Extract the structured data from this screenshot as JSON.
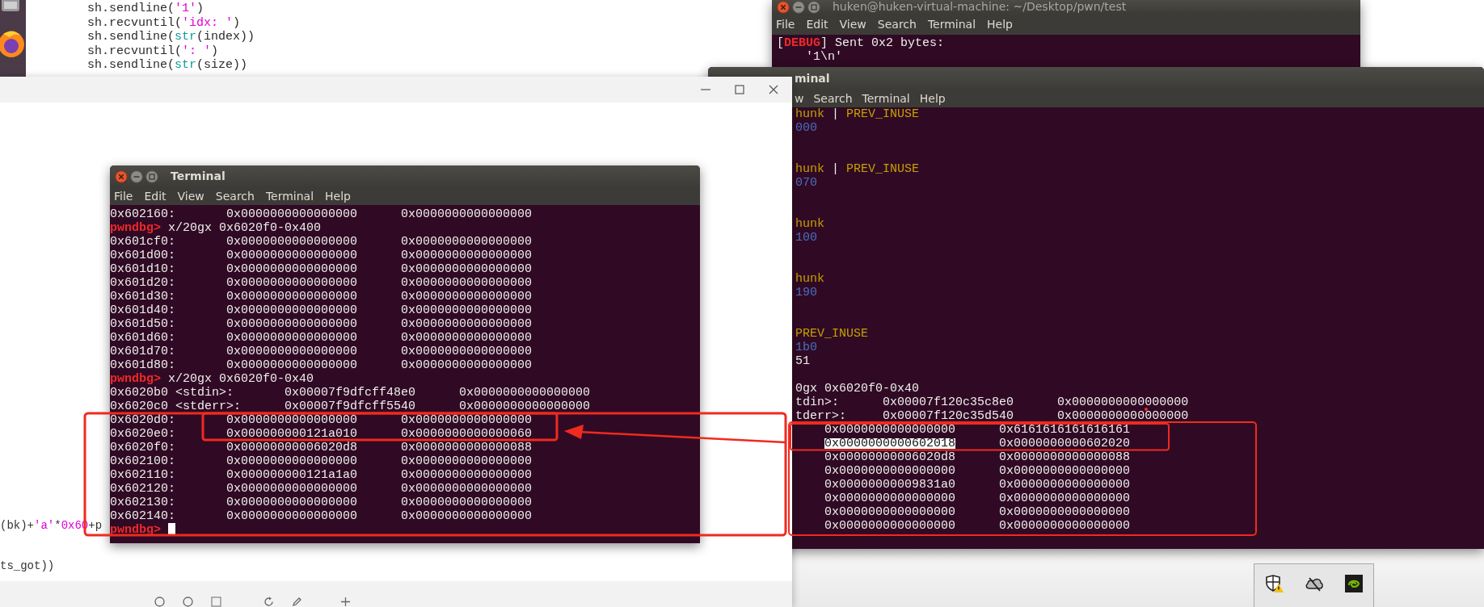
{
  "editor": {
    "code_lines": [
      [
        {
          "text": "sh.sendline(",
          "kind": "plain"
        },
        {
          "text": "'1'",
          "kind": "string"
        },
        {
          "text": ")",
          "kind": "plain"
        }
      ],
      [
        {
          "text": "sh.recvuntil(",
          "kind": "plain"
        },
        {
          "text": "'idx: '",
          "kind": "string"
        },
        {
          "text": ")",
          "kind": "plain"
        }
      ],
      [
        {
          "text": "sh.sendline(",
          "kind": "plain"
        },
        {
          "text": "str",
          "kind": "builtin"
        },
        {
          "text": "(index))",
          "kind": "plain"
        }
      ],
      [
        {
          "text": "sh.recvuntil(",
          "kind": "plain"
        },
        {
          "text": "': '",
          "kind": "string"
        },
        {
          "text": ")",
          "kind": "plain"
        }
      ],
      [
        {
          "text": "sh.sendline(",
          "kind": "plain"
        },
        {
          "text": "str",
          "kind": "builtin"
        },
        {
          "text": "(size))",
          "kind": "plain"
        }
      ]
    ]
  },
  "top_terminal": {
    "title": "huken@huken-virtual-machine: ~/Desktop/pwn/test",
    "menu": [
      "File",
      "Edit",
      "View",
      "Search",
      "Terminal",
      "Help"
    ],
    "lines": [
      {
        "kind": "output",
        "segments": [
          {
            "text": "[",
            "kind": "plain"
          },
          {
            "text": "DEBUG",
            "kind": "error"
          },
          {
            "text": "] Sent 0x2 bytes:",
            "kind": "plain"
          }
        ]
      },
      {
        "kind": "detail",
        "segments": [
          {
            "text": "'1\\n'",
            "kind": "plain"
          }
        ]
      }
    ]
  },
  "right_terminal": {
    "title": "minal",
    "menu": [
      "w",
      "Search",
      "Terminal",
      "Help"
    ],
    "heap_chunks": [
      {
        "lines": [
          [
            {
              "text": "hunk",
              "kind": "flag"
            },
            {
              "text": " | ",
              "kind": "plain"
            },
            {
              "text": "PREV_INUSE",
              "kind": "flag"
            }
          ],
          [
            {
              "text": "000",
              "kind": "address"
            }
          ]
        ]
      },
      {
        "lines": [
          [
            {
              "text": "hunk",
              "kind": "flag"
            },
            {
              "text": " | ",
              "kind": "plain"
            },
            {
              "text": "PREV_INUSE",
              "kind": "flag"
            }
          ],
          [
            {
              "text": "070",
              "kind": "address"
            }
          ]
        ]
      },
      {
        "lines": [
          [
            {
              "text": "hunk",
              "kind": "flag"
            }
          ],
          [
            {
              "text": "100",
              "kind": "address"
            }
          ]
        ]
      },
      {
        "lines": [
          [
            {
              "text": "hunk",
              "kind": "flag"
            }
          ],
          [
            {
              "text": "190",
              "kind": "address"
            }
          ]
        ]
      },
      {
        "lines": [
          [
            {
              "text": "PREV_INUSE",
              "kind": "flag"
            }
          ],
          [
            {
              "text": "1b0",
              "kind": "address"
            }
          ],
          [
            {
              "text": "51",
              "kind": "plain"
            }
          ]
        ]
      }
    ],
    "lines": [
      {
        "kind": "command",
        "command": "0gx 0x6020f0-0x40"
      },
      {
        "kind": "memory",
        "address": "tdin>:",
        "values": [
          {
            "text": "0x00007f120c35c8e0",
            "selected": false
          },
          {
            "text": "0x0000000000000000",
            "selected": false
          }
        ]
      },
      {
        "kind": "memory",
        "address": "tderr>:",
        "values": [
          {
            "text": "0x00007f120c35d540",
            "selected": false
          },
          {
            "text": "0x0000000000000000",
            "selected": false
          }
        ]
      },
      {
        "kind": "memory",
        "values": [
          {
            "text": "0x0000000000000000",
            "selected": false
          },
          {
            "text": "0x6161616161616161",
            "selected": false
          }
        ]
      },
      {
        "kind": "memory",
        "values": [
          {
            "text": "0x0000000000602018",
            "selected": true
          },
          {
            "text": "0x0000000000602020",
            "selected": false
          }
        ]
      },
      {
        "kind": "memory",
        "values": [
          {
            "text": "0x00000000006020d8",
            "selected": false
          },
          {
            "text": "0x0000000000000088",
            "selected": false
          }
        ]
      },
      {
        "kind": "memory",
        "values": [
          {
            "text": "0x0000000000000000",
            "selected": false
          },
          {
            "text": "0x0000000000000000",
            "selected": false
          }
        ]
      },
      {
        "kind": "memory",
        "values": [
          {
            "text": "0x00000000009831a0",
            "selected": false
          },
          {
            "text": "0x0000000000000000",
            "selected": false
          }
        ]
      },
      {
        "kind": "memory",
        "values": [
          {
            "text": "0x0000000000000000",
            "selected": false
          },
          {
            "text": "0x0000000000000000",
            "selected": false
          }
        ]
      },
      {
        "kind": "memory",
        "values": [
          {
            "text": "0x0000000000000000",
            "selected": false
          },
          {
            "text": "0x0000000000000000",
            "selected": false
          }
        ]
      },
      {
        "kind": "memory",
        "values": [
          {
            "text": "0x0000000000000000",
            "selected": false
          },
          {
            "text": "0x0000000000000000",
            "selected": false
          }
        ]
      }
    ]
  },
  "viewer_window": {
    "code_fragments": [
      [
        {
          "text": "(bk)+",
          "kind": "plain"
        },
        {
          "text": "'a'",
          "kind": "string"
        },
        {
          "text": "*",
          "kind": "plain"
        },
        {
          "text": "0x60",
          "kind": "string"
        },
        {
          "text": "+p",
          "kind": "plain"
        }
      ],
      [
        {
          "text": "ts_got))",
          "kind": "plain"
        }
      ]
    ]
  },
  "left_terminal": {
    "title": "Terminal",
    "menu": [
      "File",
      "Edit",
      "View",
      "Search",
      "Terminal",
      "Help"
    ],
    "lines": [
      {
        "kind": "memory",
        "address": "0x602160:",
        "values": [
          "0x0000000000000000",
          "0x0000000000000000"
        ]
      },
      {
        "kind": "command",
        "prompt": "pwndbg>",
        "command": "x/20gx 0x6020f0-0x400"
      },
      {
        "kind": "memory",
        "address": "0x601cf0:",
        "values": [
          "0x0000000000000000",
          "0x0000000000000000"
        ]
      },
      {
        "kind": "memory",
        "address": "0x601d00:",
        "values": [
          "0x0000000000000000",
          "0x0000000000000000"
        ]
      },
      {
        "kind": "memory",
        "address": "0x601d10:",
        "values": [
          "0x0000000000000000",
          "0x0000000000000000"
        ]
      },
      {
        "kind": "memory",
        "address": "0x601d20:",
        "values": [
          "0x0000000000000000",
          "0x0000000000000000"
        ]
      },
      {
        "kind": "memory",
        "address": "0x601d30:",
        "values": [
          "0x0000000000000000",
          "0x0000000000000000"
        ]
      },
      {
        "kind": "memory",
        "address": "0x601d40:",
        "values": [
          "0x0000000000000000",
          "0x0000000000000000"
        ]
      },
      {
        "kind": "memory",
        "address": "0x601d50:",
        "values": [
          "0x0000000000000000",
          "0x0000000000000000"
        ]
      },
      {
        "kind": "memory",
        "address": "0x601d60:",
        "values": [
          "0x0000000000000000",
          "0x0000000000000000"
        ]
      },
      {
        "kind": "memory",
        "address": "0x601d70:",
        "values": [
          "0x0000000000000000",
          "0x0000000000000000"
        ]
      },
      {
        "kind": "memory",
        "address": "0x601d80:",
        "values": [
          "0x0000000000000000",
          "0x0000000000000000"
        ]
      },
      {
        "kind": "command",
        "prompt": "pwndbg>",
        "command": "x/20gx 0x6020f0-0x40"
      },
      {
        "kind": "memory",
        "address": "0x6020b0 <stdin>:",
        "values": [
          "0x00007f9dfcff48e0",
          "0x0000000000000000"
        ]
      },
      {
        "kind": "memory",
        "address": "0x6020c0 <stderr>:",
        "values": [
          "0x00007f9dfcff5540",
          "0x0000000000000000"
        ]
      },
      {
        "kind": "memory",
        "address": "0x6020d0:",
        "values": [
          "0x0000000000000000",
          "0x0000000000000000"
        ]
      },
      {
        "kind": "memory",
        "address": "0x6020e0:",
        "values": [
          "0x000000000121a010",
          "0x0000000000000060"
        ]
      },
      {
        "kind": "memory",
        "address": "0x6020f0:",
        "values": [
          "0x00000000006020d8",
          "0x0000000000000088"
        ]
      },
      {
        "kind": "memory",
        "address": "0x602100:",
        "values": [
          "0x0000000000000000",
          "0x0000000000000000"
        ]
      },
      {
        "kind": "memory",
        "address": "0x602110:",
        "values": [
          "0x000000000121a1a0",
          "0x0000000000000000"
        ]
      },
      {
        "kind": "memory",
        "address": "0x602120:",
        "values": [
          "0x0000000000000000",
          "0x0000000000000000"
        ]
      },
      {
        "kind": "memory",
        "address": "0x602130:",
        "values": [
          "0x0000000000000000",
          "0x0000000000000000"
        ]
      },
      {
        "kind": "memory",
        "address": "0x602140:",
        "values": [
          "0x0000000000000000",
          "0x0000000000000000"
        ]
      },
      {
        "kind": "input",
        "prompt": "pwndbg>"
      }
    ]
  }
}
